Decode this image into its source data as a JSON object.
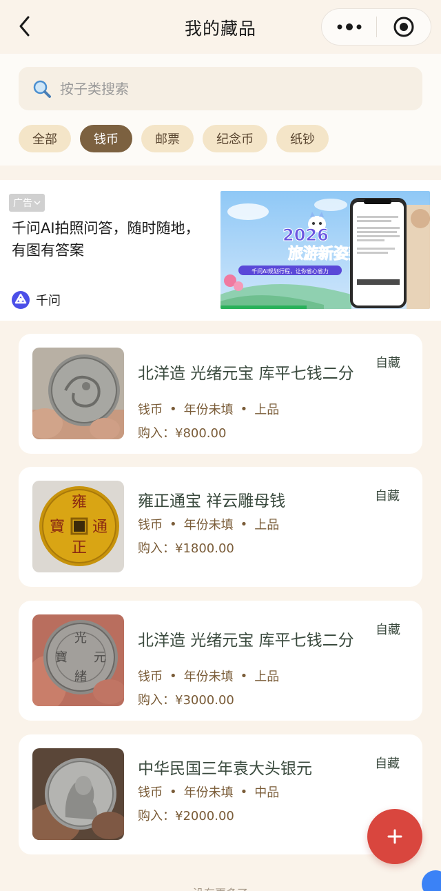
{
  "nav": {
    "title": "我的藏品"
  },
  "search": {
    "placeholder": "按子类搜索"
  },
  "filters": [
    {
      "label": "全部",
      "active": false
    },
    {
      "label": "钱币",
      "active": true
    },
    {
      "label": "邮票",
      "active": false
    },
    {
      "label": "纪念币",
      "active": false
    },
    {
      "label": "纸钞",
      "active": false
    }
  ],
  "ad": {
    "badge": "广告",
    "text": "千问AI拍照问答，随时随地，有图有答案",
    "brand": "千问",
    "image_headline_1": "2026",
    "image_headline_2": "旅游新姿势!",
    "image_subline": "千问AI规划行程，让你省心省力"
  },
  "items": [
    {
      "name": "北洋造 光绪元宝 库平七钱二分",
      "category": "钱币",
      "year": "年份未填",
      "grade": "上品",
      "price": "购入：¥800.00",
      "tag": "自藏"
    },
    {
      "name": "雍正通宝 祥云雕母钱",
      "category": "钱币",
      "year": "年份未填",
      "grade": "上品",
      "price": "购入：¥1800.00",
      "tag": "自藏"
    },
    {
      "name": "北洋造 光绪元宝 库平七钱二分",
      "category": "钱币",
      "year": "年份未填",
      "grade": "上品",
      "price": "购入：¥3000.00",
      "tag": "自藏"
    },
    {
      "name": "中华民国三年袁大头银元",
      "category": "钱币",
      "year": "年份未填",
      "grade": "中品",
      "price": "购入：¥2000.00",
      "tag": "自藏"
    }
  ],
  "coin_glyphs": {
    "yongzheng": [
      "雍",
      "正",
      "通",
      "寶"
    ],
    "guangxu": [
      "光",
      "緒",
      "元",
      "寶"
    ]
  },
  "footer": {
    "text": "没有更多了"
  },
  "colors": {
    "background": "#faf3ea",
    "chip": "#f4e5c8",
    "chip_active": "#7c6140",
    "meta_text": "#7a5c38",
    "fab": "#d9463e"
  }
}
